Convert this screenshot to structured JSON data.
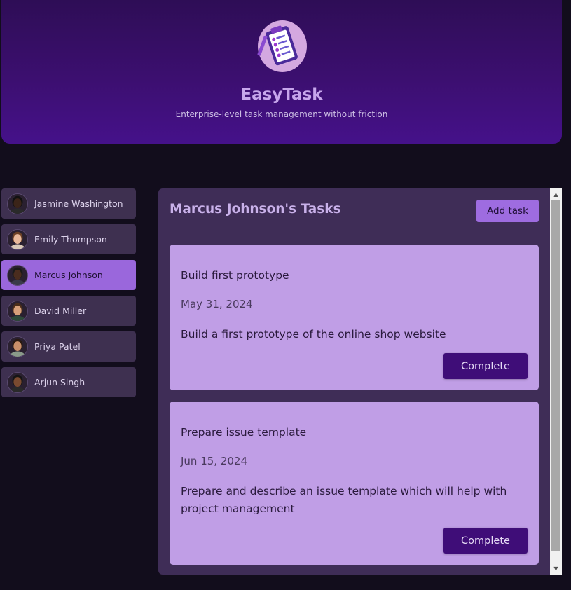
{
  "header": {
    "title": "EasyTask",
    "subtitle": "Enterprise-level task management without friction",
    "logo_icon": "clipboard-checklist-icon"
  },
  "users": [
    {
      "name": "Jasmine Washington",
      "active": false,
      "skin": "#3b2418",
      "hair": "#111111",
      "shirt": "#2a2a2a"
    },
    {
      "name": "Emily Thompson",
      "active": false,
      "skin": "#e8b89a",
      "hair": "#6b4025",
      "shirt": "#d8c8b8"
    },
    {
      "name": "Marcus Johnson",
      "active": true,
      "skin": "#4a2c1e",
      "hair": "#1a1a1a",
      "shirt": "#3a3a4a"
    },
    {
      "name": "David Miller",
      "active": false,
      "skin": "#d7a07a",
      "hair": "#4b2e1a",
      "shirt": "#2e4a3a"
    },
    {
      "name": "Priya Patel",
      "active": false,
      "skin": "#c98f6a",
      "hair": "#2a1a12",
      "shirt": "#8a9a8a"
    },
    {
      "name": "Arjun Singh",
      "active": false,
      "skin": "#7a4a30",
      "hair": "#151515",
      "shirt": "#2a2a2a"
    }
  ],
  "tasks_panel": {
    "title": "Marcus Johnson's Tasks",
    "add_task_label": "Add task"
  },
  "tasks": [
    {
      "title": "Build first prototype",
      "date": "May 31, 2024",
      "description": "Build a first prototype of the online shop website",
      "complete_label": "Complete"
    },
    {
      "title": "Prepare issue template",
      "date": "Jun 15, 2024",
      "description": "Prepare and describe an issue template which will help with project management",
      "complete_label": "Complete"
    }
  ],
  "colors": {
    "accent": "#9a67dc",
    "button_dark": "#3f0d78",
    "card": "#c09ee6",
    "panel": "#3f2d57"
  }
}
